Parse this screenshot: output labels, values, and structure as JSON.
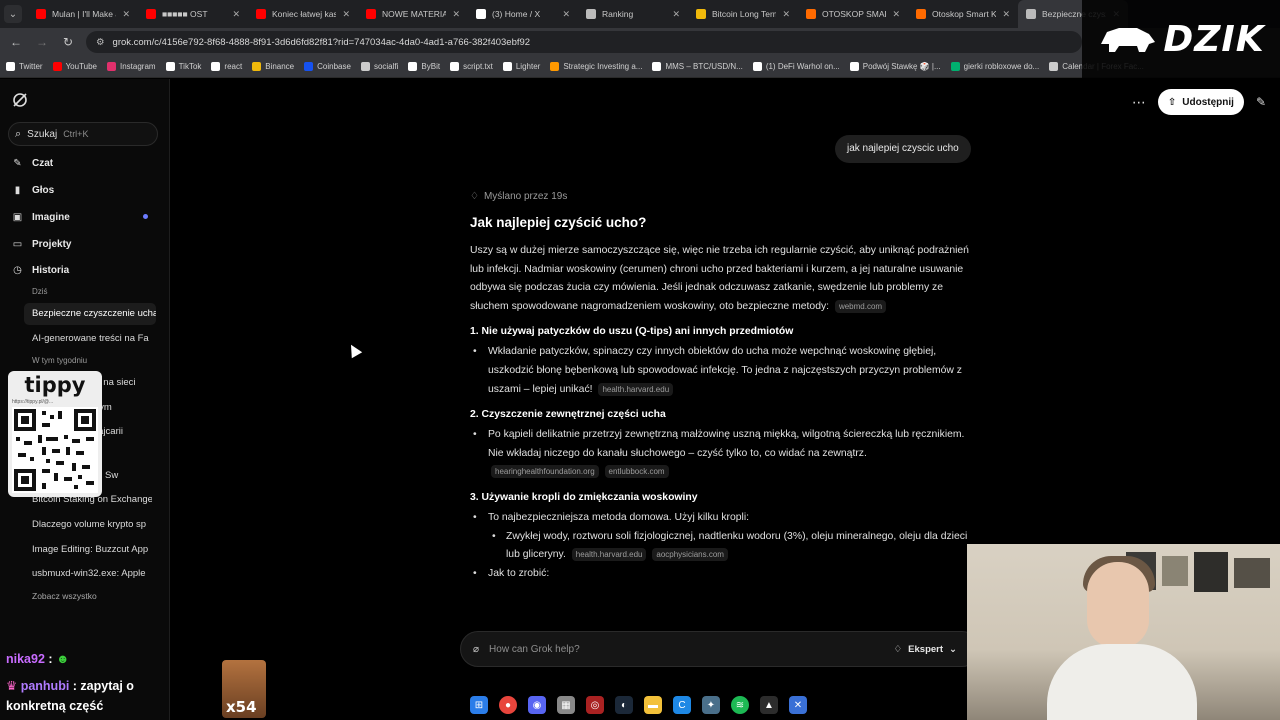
{
  "browser": {
    "tabs": [
      {
        "title": "Mulan | I'll Make a",
        "color": "#ff0000"
      },
      {
        "title": "■■■■■ OST",
        "color": "#ff0000"
      },
      {
        "title": "Koniec łatwej kasy",
        "color": "#ff0000"
      },
      {
        "title": "NOWE MATERIAŁ",
        "color": "#ff0000"
      },
      {
        "title": "(3) Home / X",
        "color": "#ffffff"
      },
      {
        "title": "Ranking",
        "color": "#bbbbbb"
      },
      {
        "title": "Bitcoin Long Term",
        "color": "#f0b90b"
      },
      {
        "title": "OTOSKOP SMART",
        "color": "#ff6a00"
      },
      {
        "title": "Otoskop Smart K",
        "color": "#ff6a00"
      },
      {
        "title": "Bezpieczne czysz",
        "color": "#bbbbbb"
      }
    ],
    "url": "grok.com/c/4156e792-8f68-4888-8f91-3d6d6fd82f81?rid=747034ac-4da0-4ad1-a766-382f403ebf92",
    "bookmarks": [
      {
        "label": "Twitter",
        "color": "#ffffff"
      },
      {
        "label": "YouTube",
        "color": "#ff0000"
      },
      {
        "label": "Instagram",
        "color": "#e1306c"
      },
      {
        "label": "TikTok",
        "color": "#ffffff"
      },
      {
        "label": "react",
        "color": "#ffffff"
      },
      {
        "label": "Binance",
        "color": "#f0b90b"
      },
      {
        "label": "Coinbase",
        "color": "#1652f0"
      },
      {
        "label": "socialfi",
        "color": "#cccccc"
      },
      {
        "label": "ByBit",
        "color": "#ffffff"
      },
      {
        "label": "script.txt",
        "color": "#ffffff"
      },
      {
        "label": "Lighter",
        "color": "#ffffff"
      },
      {
        "label": "Strategic Investing a...",
        "color": "#ff9900"
      },
      {
        "label": "MMS – BTC/USD/N...",
        "color": "#ffffff"
      },
      {
        "label": "(1) DeFi Warhol on...",
        "color": "#ffffff"
      },
      {
        "label": "Podwój Stawkę 🎲 |...",
        "color": "#ffffff"
      },
      {
        "label": "gierki robloxowe do...",
        "color": "#00b06f"
      },
      {
        "label": "Calendar | Forex Fac...",
        "color": "#cccccc"
      }
    ]
  },
  "overlay": {
    "brand": "DZIK",
    "qr_brand": "tippy",
    "qr_url": "https://tippy.pl/@..."
  },
  "sidebar": {
    "search_label": "Szukaj",
    "search_shortcut": "Ctrl+K",
    "nav": [
      {
        "label": "Czat",
        "icon": "chat-icon"
      },
      {
        "label": "Głos",
        "icon": "voice-icon"
      },
      {
        "label": "Imagine",
        "icon": "image-icon"
      },
      {
        "label": "Projekty",
        "icon": "folder-icon"
      },
      {
        "label": "Historia",
        "icon": "history-icon"
      }
    ],
    "group_today": "Dziś",
    "group_week": "W tym tygodniu",
    "history": [
      "Bezpieczne czyszczenie ucha",
      "AI-generowane treści na Fa",
      "Bezpieczeństwo na sieci",
      "Zakupy na cudzym",
      "Wakacje w Szwajcarii",
      "Troubleshooting: Sw",
      "Bitcoin Staking on Exchange",
      "Dlaczego volume krypto sp",
      "Image Editing: Buzzcut App",
      "usbmuxd-win32.exe: Apple"
    ],
    "see_all": "Zobacz wszystko"
  },
  "header": {
    "share_label": "Udostępnij"
  },
  "conversation": {
    "user_message": "jak najlepiej czyscic ucho",
    "thinking": "Myślano przez 19s",
    "title": "Jak najlepiej czyścić ucho?",
    "intro": "Uszy są w dużej mierze samoczyszczące się, więc nie trzeba ich regularnie czyścić, aby uniknąć podrażnień lub infekcji. Nadmiar woskowiny (cerumen) chroni ucho przed bakteriami i kurzem, a jej naturalne usuwanie odbywa się podczas żucia czy mówienia. Jeśli jednak odczuwasz zatkanie, swędzenie lub problemy ze słuchem spowodowane nagromadzeniem woskowiny, oto bezpieczne metody:",
    "intro_source": "webmd.com",
    "s1_title": "1. Nie używaj patyczków do uszu (Q-tips) ani innych przedmiotów",
    "s1_text": "Wkładanie patyczków, spinaczy czy innych obiektów do ucha może wepchnąć woskowinę głębiej, uszkodzić błonę bębenkową lub spowodować infekcję. To jedna z najczęstszych przyczyn problemów z uszami – lepiej unikać!",
    "s1_source": "health.harvard.edu",
    "s2_title": "2. Czyszczenie zewnętrznej części ucha",
    "s2_text": "Po kąpieli delikatnie przetrzyj zewnętrzną małżowinę uszną miękką, wilgotną ściereczką lub ręcznikiem. Nie wkładaj niczego do kanału słuchowego – czyść tylko to, co widać na zewnątrz.",
    "s2_source1": "hearinghealthfoundation.org",
    "s2_source2": "entlubbock.com",
    "s3_title": "3. Używanie kropli do zmiękczania woskowiny",
    "s3_text": "To najbezpieczniejsza metoda domowa. Użyj kilku kropli:",
    "s3_sub": "Zwykłej wody, roztworu soli fizjologicznej, nadtlenku wodoru (3%), oleju mineralnego, oleju dla dzieci lub gliceryny.",
    "s3_source1": "health.harvard.edu",
    "s3_source2": "aocphysicians.com",
    "s3_how": "Jak to zrobić:"
  },
  "composer": {
    "placeholder": "How can Grok help?",
    "mode": "Ekspert"
  },
  "stream_chat": {
    "user1": "nika92",
    "msg1": ":",
    "user2": "panhubi",
    "msg2": ": zapytaj o",
    "msg3": "konkretną część",
    "emote_text": "x54"
  }
}
